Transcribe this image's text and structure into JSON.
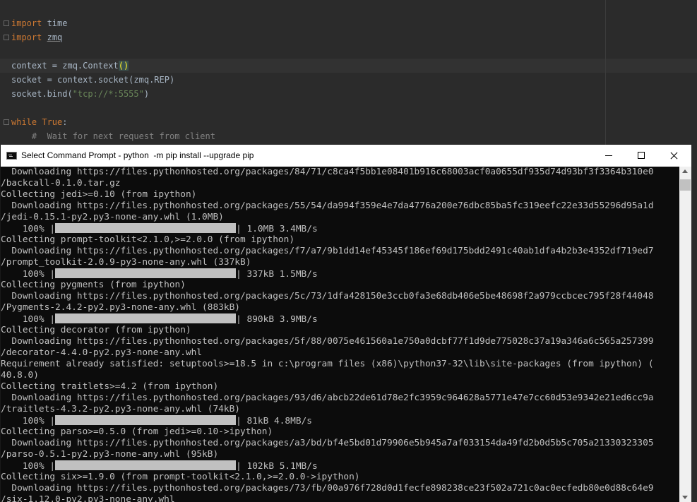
{
  "editor": {
    "lines": {
      "l1_kw": "import",
      "l1_rest": " time",
      "l2_kw": "import",
      "l2_sp": " ",
      "l2_mod": "zmq",
      "l3_pre": "context = zmq.Context",
      "l3_paren": "()",
      "l4": "socket = context.socket(zmq.REP)",
      "l5_pre": "socket.bind(",
      "l5_str": "\"tcp://*:5555\"",
      "l5_post": ")",
      "l6_kw": "while",
      "l6_true": " True",
      "l6_colon": ":",
      "l7": "    #  Wait for next request from client"
    },
    "colors": {
      "background": "#2b2b2b",
      "keyword": "#cc7832",
      "string": "#6a8759",
      "comment": "#808080",
      "text": "#a9b7c6"
    }
  },
  "cmd_window": {
    "title": "Select Command Prompt - python  -m pip install --upgrade pip",
    "icons": {
      "app": "cmd-icon",
      "minimize": "minimize-icon",
      "maximize": "maximize-icon",
      "close": "close-icon"
    },
    "lines": [
      "  Downloading https://files.pythonhosted.org/packages/84/71/c8ca4f5bb1e08401b916c68003acf0a0655df935d74d93bf3f3364b310e0",
      "/backcall-0.1.0.tar.gz",
      "Collecting jedi>=0.10 (from ipython)",
      "  Downloading https://files.pythonhosted.org/packages/55/54/da994f359e4e7da4776a200e76dbc85ba5fc319eefc22e33d55296d95a1d",
      "/jedi-0.15.1-py2.py3-none-any.whl (1.0MB)",
      "",
      "Collecting prompt-toolkit<2.1.0,>=2.0.0 (from ipython)",
      "  Downloading https://files.pythonhosted.org/packages/f7/a7/9b1dd14ef45345f186ef69d175bdd2491c40ab1dfa4b2b3e4352df719ed7",
      "/prompt_toolkit-2.0.9-py3-none-any.whl (337kB)",
      "",
      "Collecting pygments (from ipython)",
      "  Downloading https://files.pythonhosted.org/packages/5c/73/1dfa428150e3ccb0fa3e68db406e5be48698f2a979ccbcec795f28f44048",
      "/Pygments-2.4.2-py2.py3-none-any.whl (883kB)",
      "",
      "Collecting decorator (from ipython)",
      "  Downloading https://files.pythonhosted.org/packages/5f/88/0075e461560a1e750a0dcbf77f1d9de775028c37a19a346a6c565a257399",
      "/decorator-4.4.0-py2.py3-none-any.whl",
      "Requirement already satisfied: setuptools>=18.5 in c:\\program files (x86)\\python37-32\\lib\\site-packages (from ipython) (",
      "40.8.0)",
      "Collecting traitlets>=4.2 (from ipython)",
      "  Downloading https://files.pythonhosted.org/packages/93/d6/abcb22de61d78e2fc3959c964628a5771e47e7cc60d53e9342e21ed6cc9a",
      "/traitlets-4.3.2-py2.py3-none-any.whl (74kB)",
      "",
      "Collecting parso>=0.5.0 (from jedi>=0.10->ipython)",
      "  Downloading https://files.pythonhosted.org/packages/a3/bd/bf4e5bd01d79906e5b945a7af033154da49fd2b0d5b5c705a21330323305",
      "/parso-0.5.1-py2.py3-none-any.whl (95kB)",
      "",
      "Collecting six>=1.9.0 (from prompt-toolkit<2.1.0,>=2.0.0->ipython)",
      "  Downloading https://files.pythonhosted.org/packages/73/fb/00a976f728d0d1fecfe898238ce23f502a721c0ac0ecfedb80e0d88c64e9",
      "/six-1.12.0-py2.py3-none-any.whl"
    ],
    "progress": [
      {
        "percent": "100%",
        "fill_fraction": 1.0,
        "status": "1.0MB 3.4MB/s"
      },
      {
        "percent": "100%",
        "fill_fraction": 1.0,
        "status": "337kB 1.5MB/s"
      },
      {
        "percent": "100%",
        "fill_fraction": 1.0,
        "status": "890kB 3.9MB/s"
      },
      {
        "percent": "100%",
        "fill_fraction": 1.0,
        "status": "81kB 4.8MB/s"
      },
      {
        "percent": "100%",
        "fill_fraction": 1.0,
        "status": "102kB 5.1MB/s"
      }
    ],
    "colors": {
      "background": "#0c0c0c",
      "text": "#c0c0c0",
      "titlebar": "#ffffff"
    }
  }
}
